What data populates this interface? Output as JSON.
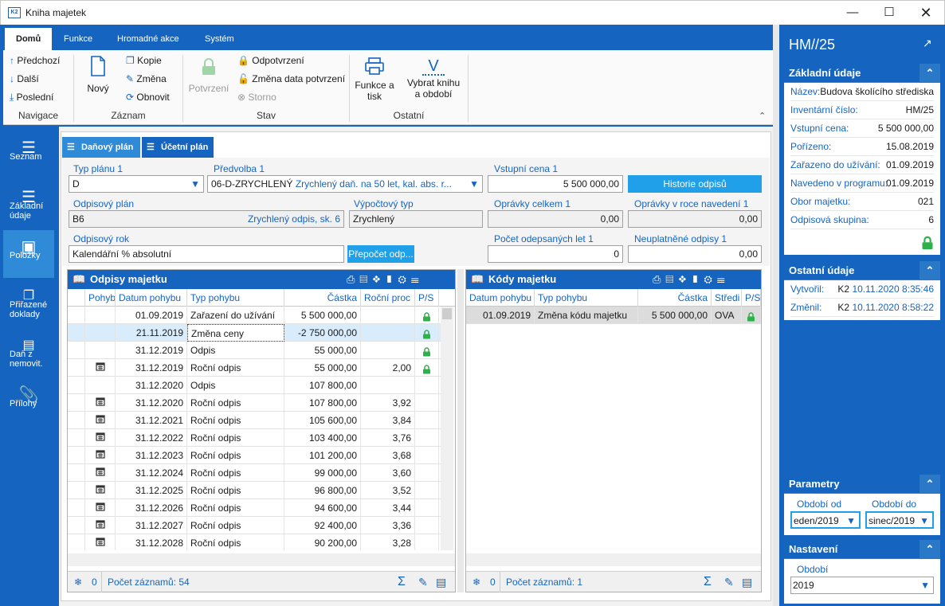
{
  "window": {
    "title": "Kniha majetek",
    "logo": "K2"
  },
  "ribbon": {
    "tabs": [
      "Domů",
      "Funkce",
      "Hromadné akce",
      "Systém"
    ],
    "navigace": {
      "label": "Navigace",
      "prev": "Předchozí",
      "next": "Další",
      "last": "Poslední"
    },
    "zaznam": {
      "label": "Záznam",
      "new": "Nový",
      "copy": "Kopie",
      "edit": "Změna",
      "refresh": "Obnovit"
    },
    "stav": {
      "label": "Stav",
      "confirm": "Potvrzení",
      "unconfirm": "Odpotvrzení",
      "change_date": "Změna data potvrzení",
      "storno": "Storno"
    },
    "ostatni": {
      "label": "Ostatní",
      "print_l1": "Funkce a",
      "print_l2": "tisk",
      "select_l1": "Vybrat knihu",
      "select_l2": "a období"
    }
  },
  "rail": [
    {
      "label1": "Seznam",
      "label2": ""
    },
    {
      "label1": "Základní",
      "label2": "údaje"
    },
    {
      "label1": "Položky",
      "label2": ""
    },
    {
      "label1": "Přiřazené",
      "label2": "doklady"
    },
    {
      "label1": "Daň z",
      "label2": "nemovit."
    },
    {
      "label1": "Přílohy",
      "label2": ""
    }
  ],
  "subtabs": [
    "Daňový plán",
    "Účetní plán"
  ],
  "form": {
    "typ_planu_label": "Typ plánu 1",
    "typ_planu": "D",
    "predvolba_label": "Předvolba 1",
    "predvolba_code": "06-D-ZRYCHLENÝ",
    "predvolba_text": "Zrychlený daň. na 50 let, kal. abs. r...",
    "vstupni_cena_label": "Vstupní cena 1",
    "vstupni_cena": "5 500 000,00",
    "historie_btn": "Historie odpisů",
    "odpisovy_plan_label": "Odpisový plán",
    "odpisovy_plan_code": "B6",
    "odpisovy_plan_text": "Zrychlený odpis, sk. 6",
    "vypoctovy_typ_label": "Výpočtový typ",
    "vypoctovy_typ": "Zrychlený",
    "opravky_celkem_label": "Oprávky celkem 1",
    "opravky_celkem": "0,00",
    "opravky_roce_label": "Oprávky v roce navedení 1",
    "opravky_roce": "0,00",
    "odpisovy_rok_label": "Odpisový rok",
    "odpisovy_rok": "Kalendářní % absolutní",
    "prepocet_btn": "Přepočet odp...",
    "pocet_let_label": "Počet odepsaných let 1",
    "pocet_let": "0",
    "neuplatnene_label": "Neuplatněné odpisy 1",
    "neuplatnene": "0,00"
  },
  "odpisy": {
    "title": "Odpisy majetku",
    "columns": [
      "Pohyb",
      "Datum pohybu",
      "Typ pohybu",
      "Částka",
      "Roční proc",
      "P/S"
    ],
    "rows": [
      {
        "icon": false,
        "date": "01.09.2019",
        "type": "Zařazení do užívání",
        "amount": "5 500 000,00",
        "pct": "",
        "lock": true
      },
      {
        "icon": false,
        "date": "21.11.2019",
        "type": "Změna ceny",
        "amount": "-2 750 000,00",
        "pct": "",
        "lock": true
      },
      {
        "icon": false,
        "date": "31.12.2019",
        "type": "Odpis",
        "amount": "55 000,00",
        "pct": "",
        "lock": true
      },
      {
        "icon": true,
        "date": "31.12.2019",
        "type": "Roční odpis",
        "amount": "55 000,00",
        "pct": "2,00",
        "lock": true
      },
      {
        "icon": false,
        "date": "31.12.2020",
        "type": "Odpis",
        "amount": "107 800,00",
        "pct": "",
        "lock": false
      },
      {
        "icon": true,
        "date": "31.12.2020",
        "type": "Roční odpis",
        "amount": "107 800,00",
        "pct": "3,92",
        "lock": false
      },
      {
        "icon": true,
        "date": "31.12.2021",
        "type": "Roční odpis",
        "amount": "105 600,00",
        "pct": "3,84",
        "lock": false
      },
      {
        "icon": true,
        "date": "31.12.2022",
        "type": "Roční odpis",
        "amount": "103 400,00",
        "pct": "3,76",
        "lock": false
      },
      {
        "icon": true,
        "date": "31.12.2023",
        "type": "Roční odpis",
        "amount": "101 200,00",
        "pct": "3,68",
        "lock": false
      },
      {
        "icon": true,
        "date": "31.12.2024",
        "type": "Roční odpis",
        "amount": "99 000,00",
        "pct": "3,60",
        "lock": false
      },
      {
        "icon": true,
        "date": "31.12.2025",
        "type": "Roční odpis",
        "amount": "96 800,00",
        "pct": "3,52",
        "lock": false
      },
      {
        "icon": true,
        "date": "31.12.2026",
        "type": "Roční odpis",
        "amount": "94 600,00",
        "pct": "3,44",
        "lock": false
      },
      {
        "icon": true,
        "date": "31.12.2027",
        "type": "Roční odpis",
        "amount": "92 400,00",
        "pct": "3,36",
        "lock": false
      },
      {
        "icon": true,
        "date": "31.12.2028",
        "type": "Roční odpis",
        "amount": "90 200,00",
        "pct": "3,28",
        "lock": false
      }
    ],
    "footer_count": "0",
    "footer_records": "Počet záznamů: 54"
  },
  "kody": {
    "title": "Kódy majetku",
    "columns": [
      "Datum pohybu",
      "Typ pohybu",
      "Částka",
      "Středi",
      "P/S"
    ],
    "rows": [
      {
        "date": "01.09.2019",
        "type": "Změna kódu majetku",
        "amount": "5 500 000,00",
        "center": "OVA",
        "lock": true
      }
    ],
    "footer_count": "0",
    "footer_records": "Počet záznamů: 1"
  },
  "right": {
    "title": "HM//25",
    "zakladni": {
      "title": "Základní údaje",
      "items": [
        {
          "label": "Název:",
          "value": "Budova školícího střediska"
        },
        {
          "label": "Inventární číslo:",
          "value": "HM/25"
        },
        {
          "label": "Vstupní cena:",
          "value": "5 500 000,00"
        },
        {
          "label": "Pořízeno:",
          "value": "15.08.2019"
        },
        {
          "label": "Zařazeno do užívání:",
          "value": "01.09.2019"
        },
        {
          "label": "Navedeno v programu:",
          "value": "01.09.2019"
        },
        {
          "label": "Obor majetku:",
          "value": "021"
        },
        {
          "label": "Odpisová skupina:",
          "value": "6"
        }
      ]
    },
    "ostatni": {
      "title": "Ostatní údaje",
      "created_label": "Vytvořil:",
      "created_user": "K2",
      "created_date": "10.11.2020 8:35:46",
      "changed_label": "Změnil:",
      "changed_user": "K2",
      "changed_date": "10.11.2020 8:58:22"
    },
    "parametry": {
      "title": "Parametry",
      "od_label": "Období od",
      "od_value": "eden/2019",
      "do_label": "Období do",
      "do_value": "sinec/2019"
    },
    "nastaveni": {
      "title": "Nastavení",
      "obdobi_label": "Období",
      "obdobi_value": "2019"
    }
  },
  "colors": {
    "primary": "#1565c0",
    "accent": "#2f8ad8",
    "button": "#1fa0e8",
    "lock": "#2fb04a"
  }
}
